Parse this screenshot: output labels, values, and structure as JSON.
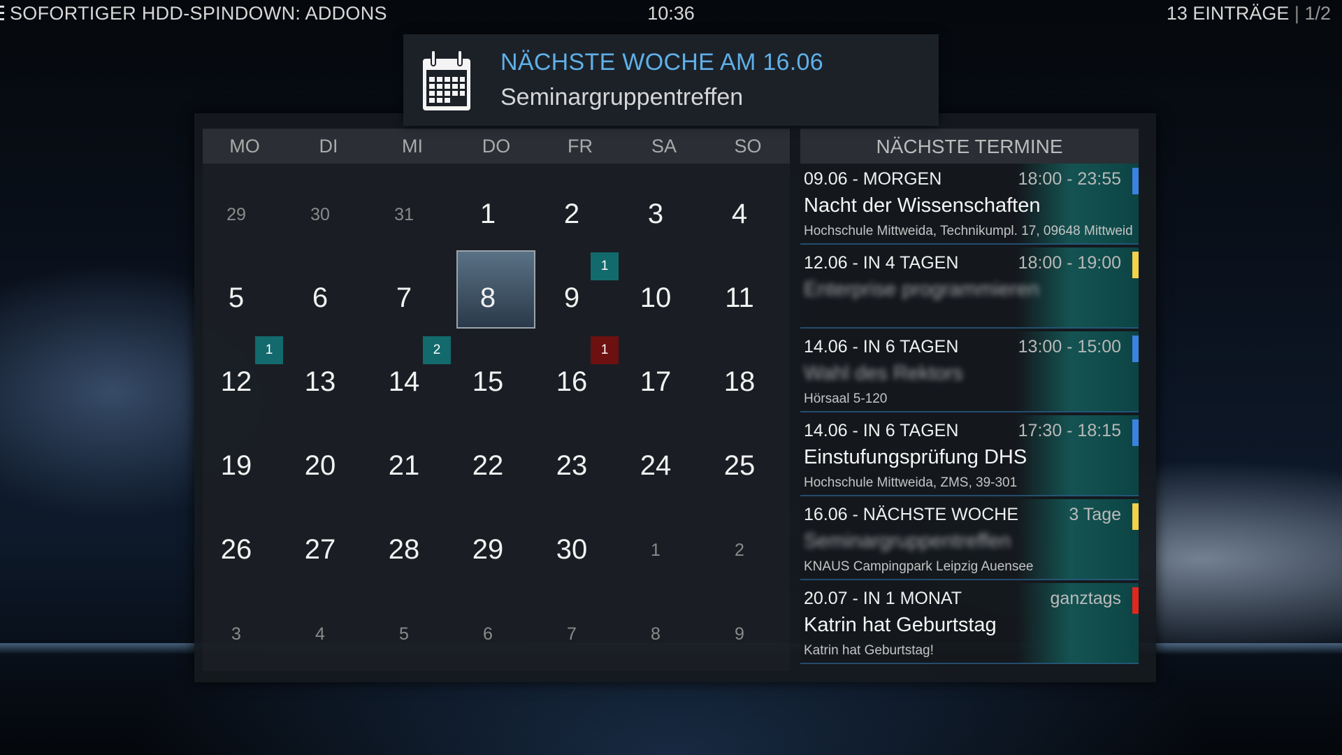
{
  "header": {
    "title": "SOFORTIGER HDD-SPINDOWN: ADDONS",
    "clock": "10:36",
    "entries": "13 EINTRÄGE",
    "separator": "|",
    "page": "1/2"
  },
  "notification": {
    "icon": "calendar-icon",
    "title": "NÄCHSTE WOCHE AM 16.06",
    "text": "Seminargruppentreffen"
  },
  "calendar": {
    "weekdays": [
      "MO",
      "DI",
      "MI",
      "DO",
      "FR",
      "SA",
      "SO"
    ],
    "weeks": [
      [
        "29",
        "30",
        "31",
        "1",
        "2",
        "3",
        "4"
      ],
      [
        "5",
        "6",
        "7",
        "8",
        "9",
        "10",
        "11"
      ],
      [
        "12",
        "13",
        "14",
        "15",
        "16",
        "17",
        "18"
      ],
      [
        "19",
        "20",
        "21",
        "22",
        "23",
        "24",
        "25"
      ],
      [
        "26",
        "27",
        "28",
        "29",
        "30",
        "1",
        "2"
      ],
      [
        "3",
        "4",
        "5",
        "6",
        "7",
        "8",
        "9"
      ]
    ],
    "selected_day": "8",
    "badges": [
      {
        "day": "9",
        "count": "1",
        "color": "#126a6d"
      },
      {
        "day": "12",
        "count": "1",
        "color": "#126a6d"
      },
      {
        "day": "14",
        "count": "2",
        "color": "#126a6d"
      },
      {
        "day": "16",
        "count": "1",
        "color": "#6d1010"
      }
    ]
  },
  "upcoming": {
    "title": "NÄCHSTE TERMINE",
    "events": [
      {
        "date": "09.06 - MORGEN",
        "time": "18:00 - 23:55",
        "title": "Nacht der Wissenschaften",
        "location": "Hochschule Mittweida, Technikumpl. 17, 09648 Mittweida",
        "color": "#3b82e0"
      },
      {
        "date": "12.06 - IN 4 TAGEN",
        "time": "18:00 - 19:00",
        "title": "Enterprise programmieren",
        "location": "",
        "color": "#f1d24a"
      },
      {
        "date": "14.06 - IN 6 TAGEN",
        "time": "13:00 - 15:00",
        "title": "Wahl des Rektors",
        "location": "Hörsaal 5-120",
        "color": "#3b82e0"
      },
      {
        "date": "14.06 - IN 6 TAGEN",
        "time": "17:30 - 18:15",
        "title": "Einstufungsprüfung DHS",
        "location": "Hochschule Mittweida, ZMS, 39-301",
        "color": "#3b82e0"
      },
      {
        "date": "16.06 - NÄCHSTE WOCHE",
        "time": "3 Tage",
        "title": "Seminargruppentreffen",
        "location": "KNAUS Campingpark Leipzig Auensee",
        "color": "#f1d24a"
      },
      {
        "date": "20.07 - IN 1 MONAT",
        "time": "ganztags",
        "title": "Katrin hat Geburtstag",
        "location": "Katrin hat Geburtstag!",
        "color": "#e0281e"
      }
    ]
  }
}
